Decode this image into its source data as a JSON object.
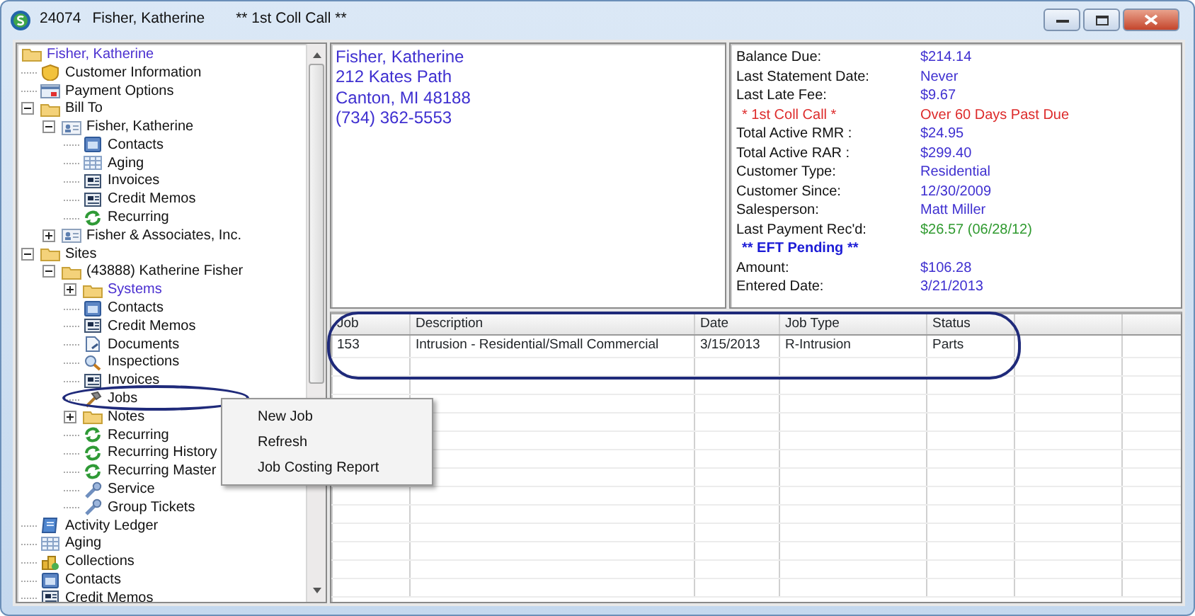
{
  "window": {
    "account": "24074",
    "title": "Fisher, Katherine",
    "alert": "** 1st Coll Call **"
  },
  "tree": [
    {
      "label": "Fisher, Katherine",
      "kind": "folder",
      "highlighted": true,
      "children": [
        {
          "label": "Customer Information",
          "kind": "shield",
          "highlighted": false
        },
        {
          "label": "Payment Options",
          "kind": "card",
          "highlighted": false
        },
        {
          "label": "Bill To",
          "kind": "folder",
          "highlighted": false,
          "expanded": true,
          "children": [
            {
              "label": "Fisher, Katherine",
              "kind": "person",
              "highlighted": false,
              "expanded": true,
              "children": [
                {
                  "label": "Contacts",
                  "kind": "contacts",
                  "highlighted": false
                },
                {
                  "label": "Aging",
                  "kind": "grid",
                  "highlighted": false
                },
                {
                  "label": "Invoices",
                  "kind": "invoice",
                  "highlighted": false
                },
                {
                  "label": "Credit Memos",
                  "kind": "invoice",
                  "highlighted": false
                },
                {
                  "label": "Recurring",
                  "kind": "recurring",
                  "highlighted": false
                }
              ]
            },
            {
              "label": "Fisher & Associates, Inc.",
              "kind": "person",
              "highlighted": false,
              "expanded": false
            }
          ]
        },
        {
          "label": "Sites",
          "kind": "folder",
          "highlighted": false,
          "expanded": true,
          "children": [
            {
              "label": "(43888) Katherine Fisher",
              "kind": "folder",
              "highlighted": false,
              "expanded": true,
              "children": [
                {
                  "label": "Systems",
                  "kind": "folder",
                  "highlighted": true,
                  "expanded": false
                },
                {
                  "label": "Contacts",
                  "kind": "contacts",
                  "highlighted": false
                },
                {
                  "label": "Credit Memos",
                  "kind": "invoice",
                  "highlighted": false
                },
                {
                  "label": "Documents",
                  "kind": "document",
                  "highlighted": false
                },
                {
                  "label": "Inspections",
                  "kind": "magnifier",
                  "highlighted": false
                },
                {
                  "label": "Invoices",
                  "kind": "invoice",
                  "highlighted": false
                },
                {
                  "label": "Jobs",
                  "kind": "hammer",
                  "highlighted": false
                },
                {
                  "label": "Notes",
                  "kind": "folder",
                  "highlighted": false,
                  "expanded": false
                },
                {
                  "label": "Recurring",
                  "kind": "recurring",
                  "highlighted": false
                },
                {
                  "label": "Recurring History",
                  "kind": "recurring",
                  "highlighted": false
                },
                {
                  "label": "Recurring Master",
                  "kind": "recurring",
                  "highlighted": false
                },
                {
                  "label": "Service",
                  "kind": "wrench",
                  "highlighted": false
                },
                {
                  "label": "Group Tickets",
                  "kind": "wrench",
                  "highlighted": false
                }
              ]
            }
          ]
        },
        {
          "label": "Activity Ledger",
          "kind": "ledger",
          "highlighted": false
        },
        {
          "label": "Aging",
          "kind": "grid",
          "highlighted": false
        },
        {
          "label": "Collections",
          "kind": "coins",
          "highlighted": false
        },
        {
          "label": "Contacts",
          "kind": "contacts",
          "highlighted": false
        },
        {
          "label": "Credit Memos",
          "kind": "invoice",
          "highlighted": false
        }
      ]
    }
  ],
  "address": [
    "Fisher, Katherine",
    "212  Kates Path",
    "Canton, MI  48188",
    "(734) 362-5553"
  ],
  "summary": [
    {
      "label": "Balance Due:",
      "value": "$214.14",
      "kind": "normal"
    },
    {
      "label": "Last Statement Date:",
      "value": "Never",
      "kind": "normal"
    },
    {
      "label": "Last Late Fee:",
      "value": "$9.67",
      "kind": "normal"
    },
    {
      "label": "* 1st Coll Call *",
      "value": "Over 60 Days Past Due",
      "kind": "alert"
    },
    {
      "label": "Total Active RMR :",
      "value": "$24.95",
      "kind": "normal"
    },
    {
      "label": "Total Active RAR :",
      "value": "$299.40",
      "kind": "normal"
    },
    {
      "label": "Customer Type:",
      "value": "Residential",
      "kind": "normal"
    },
    {
      "label": "Customer Since:",
      "value": "12/30/2009",
      "kind": "normal"
    },
    {
      "label": "Salesperson:",
      "value": "Matt Miller",
      "kind": "normal"
    },
    {
      "label": "Last Payment Rec'd:",
      "value": "$26.57 (06/28/12)",
      "kind": "payment"
    },
    {
      "label": "** EFT Pending **",
      "kind": "section"
    },
    {
      "label": "Amount:",
      "value": "$106.28",
      "kind": "normal"
    },
    {
      "label": "Entered Date:",
      "value": "3/21/2013",
      "kind": "normal"
    }
  ],
  "jobs_table": {
    "columns": [
      "Job",
      "Description",
      "Date",
      "Job Type",
      "Status"
    ],
    "rows": [
      [
        "153",
        "Intrusion - Residential/Small Commercial",
        "3/15/2013",
        "R-Intrusion",
        "Parts"
      ]
    ]
  },
  "context_menu": [
    "New Job",
    "Refresh",
    "Job Costing Report"
  ]
}
